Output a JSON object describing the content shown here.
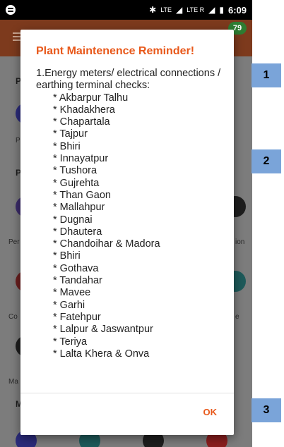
{
  "status_bar": {
    "time": "6:09",
    "network_1": "LTE",
    "network_2": "LTE R"
  },
  "app_bar": {
    "badge": "79"
  },
  "background": {
    "heading_1": "P",
    "heading_2": "P",
    "heading_3": "M",
    "label_1": "P",
    "label_2": "Per",
    "label_3": "ion",
    "label_4": "Co",
    "label_5": "e",
    "label_6": "Ma"
  },
  "dialog": {
    "title": "Plant Maintenence Reminder!",
    "intro": "1.Energy meters/ electrical connections / earthing terminal checks:",
    "sites": [
      "* Akbarpur Talhu",
      "* Khadakhera",
      "* Chapartala",
      "* Tajpur",
      "* Bhiri",
      "* Innayatpur",
      "* Tushora",
      "* Gujrehta",
      "* Than Gaon",
      "* Mallahpur",
      "* Dugnai",
      "* Dhautera",
      "* Chandoihar & Madora",
      "* Bhiri",
      "* Gothava",
      "* Tandahar",
      "* Mavee",
      "* Garhi",
      "* Fatehpur",
      "* Lalpur & Jaswantpur",
      "* Teriya",
      "* Lalta Khera & Onva"
    ],
    "ok_label": "OK"
  },
  "markers": [
    "1",
    "2",
    "3"
  ],
  "colors": {
    "accent": "#e8581a",
    "marker": "#7aa4d9",
    "badge": "#2e7d32",
    "app_bar": "#7d3a1d"
  }
}
